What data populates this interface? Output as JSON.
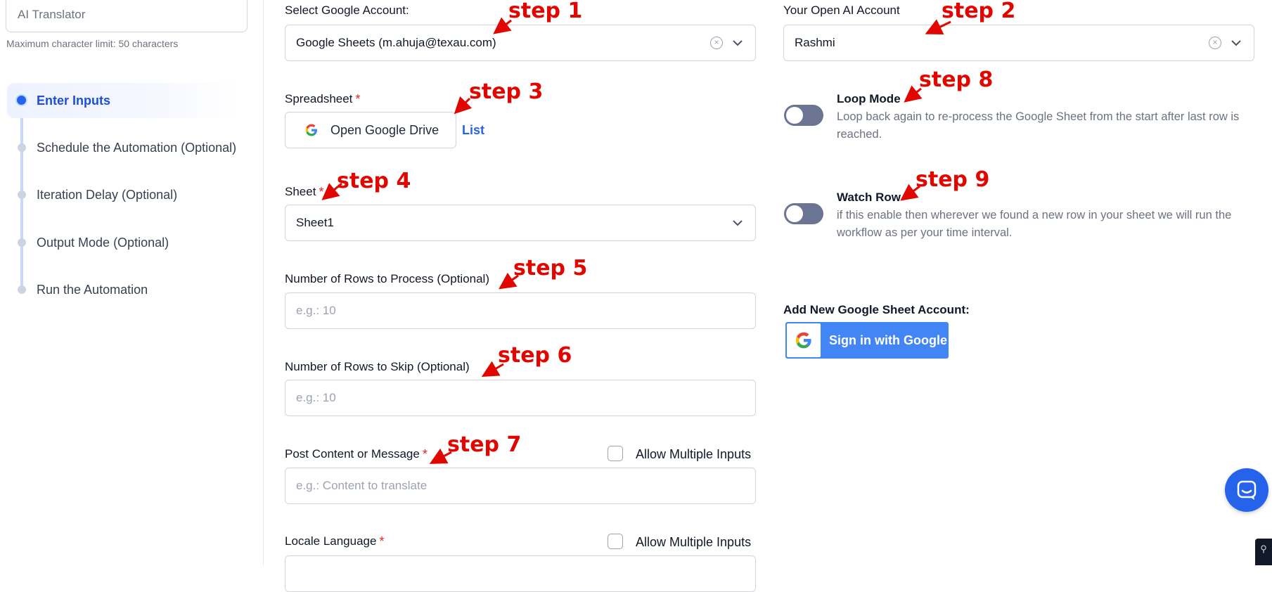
{
  "sidebar": {
    "name_value": "AI Translator",
    "char_limit": "Maximum character limit: 50 characters",
    "steps": [
      {
        "label": "Enter Inputs",
        "active": true
      },
      {
        "label": "Schedule the Automation (Optional)",
        "active": false
      },
      {
        "label": "Iteration Delay (Optional)",
        "active": false
      },
      {
        "label": "Output Mode (Optional)",
        "active": false
      },
      {
        "label": "Run the Automation",
        "active": false
      }
    ]
  },
  "form": {
    "google_account": {
      "label": "Select Google Account:",
      "value": "Google Sheets (m.ahuja@texau.com)"
    },
    "spreadsheet": {
      "label": "Spreadsheet",
      "button": "Open Google Drive",
      "link": "List"
    },
    "sheet": {
      "label": "Sheet",
      "value": "Sheet1"
    },
    "rows_to_process": {
      "label": "Number of Rows to Process (Optional)",
      "placeholder": "e.g.: 10"
    },
    "rows_to_skip": {
      "label": "Number of Rows to Skip (Optional)",
      "placeholder": "e.g.: 10"
    },
    "post_content": {
      "label": "Post Content or Message",
      "placeholder": "e.g.: Content to translate",
      "multi": "Allow Multiple Inputs"
    },
    "locale_language": {
      "label": "Locale Language",
      "multi": "Allow Multiple Inputs"
    }
  },
  "right": {
    "openai_account": {
      "label": "Your Open AI Account",
      "value": "Rashmi"
    },
    "loop_mode": {
      "title": "Loop Mode",
      "desc": "Loop back again to re-process the Google Sheet from the start after last row is reached.",
      "enabled": false
    },
    "watch_row": {
      "title": "Watch Row",
      "desc": "if this enable then wherever we found a new row in your sheet we will run the workflow as per your time interval.",
      "enabled": false
    },
    "add_account_label": "Add New Google Sheet Account:",
    "google_signin": "Sign in with Google"
  },
  "annotations": [
    "step 1",
    "step 2",
    "step 3",
    "step 4",
    "step 5",
    "step 6",
    "step 7",
    "step 8",
    "step 9"
  ],
  "colors": {
    "accent": "#2563eb",
    "annotation": "#e10600",
    "toggle_off": "#6b7593"
  }
}
